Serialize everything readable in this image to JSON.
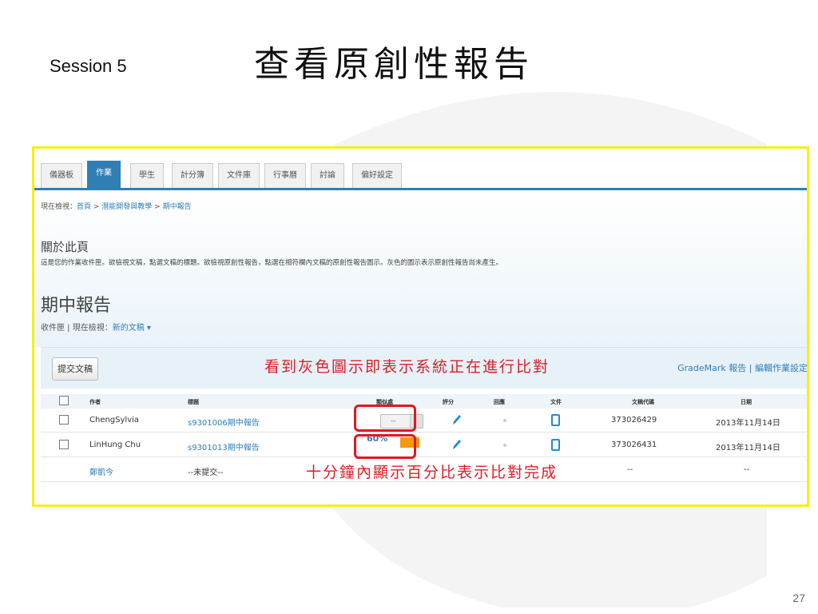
{
  "slide": {
    "session": "Session 5",
    "title": "查看原創性報告",
    "page_number": "27"
  },
  "tabs": [
    {
      "label": "儀器板",
      "active": false
    },
    {
      "label": "作業",
      "active": true
    },
    {
      "label": "學生",
      "active": false
    },
    {
      "label": "計分簿",
      "active": false
    },
    {
      "label": "文件庫",
      "active": false
    },
    {
      "label": "行事曆",
      "active": false
    },
    {
      "label": "討論",
      "active": false
    },
    {
      "label": "偏好設定",
      "active": false
    }
  ],
  "breadcrumb": {
    "prefix": "現在檢視：",
    "home": "首頁",
    "course": "潛能開發與教學",
    "current": "期中報告",
    "sep": " > "
  },
  "about": {
    "heading": "關於此頁",
    "text": "這是您的作業收件匣。欲檢視文稿，點選文稿的標題。欲檢視原創性報告，點選在相符欄內文稿的原創性報告圖示。灰色的圖示表示原創性報告尚未產生。"
  },
  "assignment": {
    "heading": "期中報告",
    "view_prefix": "收件匣 | 現在檢視：",
    "view_link": "新的文稿 ▾"
  },
  "toolbar": {
    "submit_label": "提交文稿",
    "gradmark_label": "GradeMark 報告",
    "separator": " | ",
    "edit_label": "編輯作業設定"
  },
  "annotations": {
    "gray_icon_note": "看到灰色圖示即表示系統正在進行比對",
    "percent_note": "十分鐘內顯示百分比表示比對完成"
  },
  "table": {
    "headers": [
      "作者",
      "標題",
      "類似處",
      "評分",
      "回應",
      "文件",
      "文稿代碼",
      "日期"
    ],
    "rows": [
      {
        "author": "ChengSylvia",
        "title": "s9301006期中報告",
        "similarity": "--",
        "doc_id": "373026429",
        "date": "2013年11月14日"
      },
      {
        "author": "LinHung Chu",
        "title": "s9301013期中報告",
        "similarity": "60%",
        "doc_id": "373026431",
        "date": "2013年11月14日"
      },
      {
        "author": "鄭凱今",
        "title": "--未提交--",
        "doc_id": "--",
        "date": "--"
      }
    ]
  },
  "colors": {
    "accent_blue": "#2f7fb5",
    "frame_yellow": "#f5ef1a",
    "annotation_red": "#d8202a",
    "similarity_orange": "#f39a10"
  }
}
